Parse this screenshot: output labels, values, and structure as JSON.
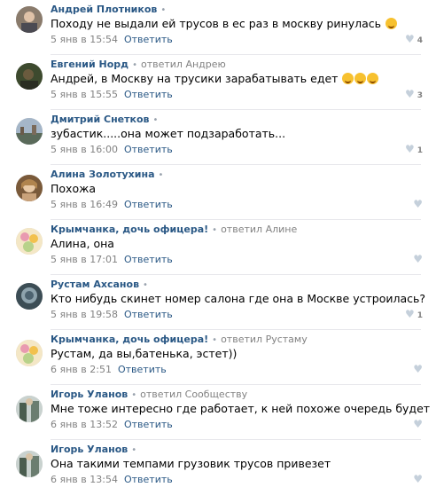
{
  "comments": [
    {
      "author": "Андрей Плотников",
      "reply_label": "",
      "reply_to": "",
      "text": "Походу не выдали ей трусов в ес раз в москву ринулась",
      "emojis": [
        "grinning-face"
      ],
      "date": "5 янв в 15:54",
      "answer": "Ответить",
      "likes": "4"
    },
    {
      "author": "Евгений Норд",
      "reply_label": "ответил",
      "reply_to": "Андрею",
      "text": "Андрей, в Москву на трусики зарабатывать едет",
      "emojis": [
        "laughing-face",
        "laughing-face",
        "laughing-face"
      ],
      "date": "5 янв в 15:55",
      "answer": "Ответить",
      "likes": "3"
    },
    {
      "author": "Дмитрий Снетков",
      "reply_label": "",
      "reply_to": "",
      "text": "зубастик.....она может подзаработать...",
      "emojis": [],
      "date": "5 янв в 16:00",
      "answer": "Ответить",
      "likes": "1"
    },
    {
      "author": "Алина Золотухина",
      "reply_label": "",
      "reply_to": "",
      "text": "Похожа",
      "emojis": [],
      "date": "5 янв в 16:49",
      "answer": "Ответить",
      "likes": ""
    },
    {
      "author": "Крымчанка, дочь офицера!",
      "reply_label": "ответил",
      "reply_to": "Алине",
      "text": "Алина, она",
      "emojis": [],
      "date": "5 янв в 17:01",
      "answer": "Ответить",
      "likes": ""
    },
    {
      "author": "Рустам Ахсанов",
      "reply_label": "",
      "reply_to": "",
      "text": "Кто нибудь скинет номер салона где она в Москве устроилась?",
      "emojis": [],
      "date": "5 янв в 19:58",
      "answer": "Ответить",
      "likes": "1"
    },
    {
      "author": "Крымчанка, дочь офицера!",
      "reply_label": "ответил",
      "reply_to": "Рустаму",
      "text": "Рустам, да вы,батенька, эстет))",
      "emojis": [],
      "date": "6 янв в 2:51",
      "answer": "Ответить",
      "likes": ""
    },
    {
      "author": "Игорь Уланов",
      "reply_label": "ответил",
      "reply_to": "Сообществу",
      "text": "Мне тоже интересно где работает, к ней похоже очередь будет",
      "emojis": [],
      "date": "6 янв в 13:52",
      "answer": "Ответить",
      "likes": ""
    },
    {
      "author": "Игорь Уланов",
      "reply_label": "",
      "reply_to": "",
      "text": "Она такими темпами грузовик трусов привезет",
      "emojis": [],
      "date": "6 янв в 13:54",
      "answer": "Ответить",
      "likes": ""
    }
  ],
  "icons": {
    "like": "heart-icon",
    "separator": "dot"
  },
  "colors": {
    "link": "#2a5885",
    "muted": "#828282",
    "heart": "#c5d0db",
    "divider": "#e7e8ec"
  }
}
